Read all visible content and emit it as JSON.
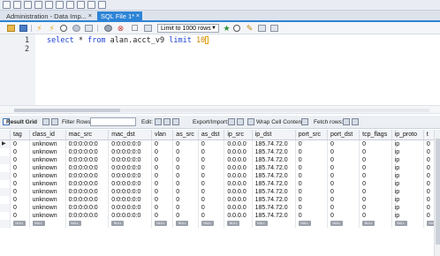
{
  "tabs": [
    {
      "label": "Administration - Data Imp...",
      "closable": true,
      "active": false
    },
    {
      "label": "SQL File 1*",
      "closable": true,
      "active": true
    }
  ],
  "query_toolbar": {
    "limit_select": "Limit to 1000 rows"
  },
  "editor": {
    "line_numbers": [
      "1",
      "2"
    ],
    "code": {
      "kw1": "select",
      "middle": " * ",
      "kw2": "from",
      "table": " alan.acct_v9 ",
      "kw3": "limit",
      "space": " ",
      "limit_value": "10"
    }
  },
  "result_toolbar": {
    "result_grid": "Result Grid",
    "filter_rows": "Filter Rows:",
    "edit": "Edit:",
    "export_import": "Export/Import:",
    "wrap": "Wrap Cell Content:",
    "fetch_rows": "Fetch rows:"
  },
  "grid": {
    "columns": [
      "tag",
      "class_id",
      "mac_src",
      "mac_dst",
      "vlan",
      "as_src",
      "as_dst",
      "ip_src",
      "ip_dst",
      "port_src",
      "port_dst",
      "tcp_flags",
      "ip_proto",
      "t"
    ],
    "rows": [
      [
        "0",
        "unknown",
        "0:0:0:0:0:0",
        "0:0:0:0:0:0",
        "0",
        "0",
        "0",
        "0.0.0.0",
        "185.74.72.0",
        "0",
        "0",
        "0",
        "ip",
        "0"
      ],
      [
        "0",
        "unknown",
        "0:0:0:0:0:0",
        "0:0:0:0:0:0",
        "0",
        "0",
        "0",
        "0.0.0.0",
        "185.74.72.0",
        "0",
        "0",
        "0",
        "ip",
        "0"
      ],
      [
        "0",
        "unknown",
        "0:0:0:0:0:0",
        "0:0:0:0:0:0",
        "0",
        "0",
        "0",
        "0.0.0.0",
        "185.74.72.0",
        "0",
        "0",
        "0",
        "ip",
        "0"
      ],
      [
        "0",
        "unknown",
        "0:0:0:0:0:0",
        "0:0:0:0:0:0",
        "0",
        "0",
        "0",
        "0.0.0.0",
        "185.74.72.0",
        "0",
        "0",
        "0",
        "ip",
        "0"
      ],
      [
        "0",
        "unknown",
        "0:0:0:0:0:0",
        "0:0:0:0:0:0",
        "0",
        "0",
        "0",
        "0.0.0.0",
        "185.74.72.0",
        "0",
        "0",
        "0",
        "ip",
        "0"
      ],
      [
        "0",
        "unknown",
        "0:0:0:0:0:0",
        "0:0:0:0:0:0",
        "0",
        "0",
        "0",
        "0.0.0.0",
        "185.74.72.0",
        "0",
        "0",
        "0",
        "ip",
        "0"
      ],
      [
        "0",
        "unknown",
        "0:0:0:0:0:0",
        "0:0:0:0:0:0",
        "0",
        "0",
        "0",
        "0.0.0.0",
        "185.74.72.0",
        "0",
        "0",
        "0",
        "ip",
        "0"
      ],
      [
        "0",
        "unknown",
        "0:0:0:0:0:0",
        "0:0:0:0:0:0",
        "0",
        "0",
        "0",
        "0.0.0.0",
        "185.74.72.0",
        "0",
        "0",
        "0",
        "ip",
        "0"
      ],
      [
        "0",
        "unknown",
        "0:0:0:0:0:0",
        "0:0:0:0:0:0",
        "0",
        "0",
        "0",
        "0.0.0.0",
        "185.74.72.0",
        "0",
        "0",
        "0",
        "ip",
        "0"
      ],
      [
        "0",
        "unknown",
        "0:0:0:0:0:0",
        "0:0:0:0:0:0",
        "0",
        "0",
        "0",
        "0.0.0.0",
        "185.74.72.0",
        "0",
        "0",
        "0",
        "ip",
        "0"
      ]
    ],
    "null_label": "NULL",
    "current_row_marker": "▶"
  },
  "colors": {
    "accent": "#2e84d6",
    "keyword": "#1f43d6",
    "number": "#cc8600"
  },
  "icons": {
    "tab_close": "close-icon",
    "select_arrow": "chevron-down-icon"
  }
}
